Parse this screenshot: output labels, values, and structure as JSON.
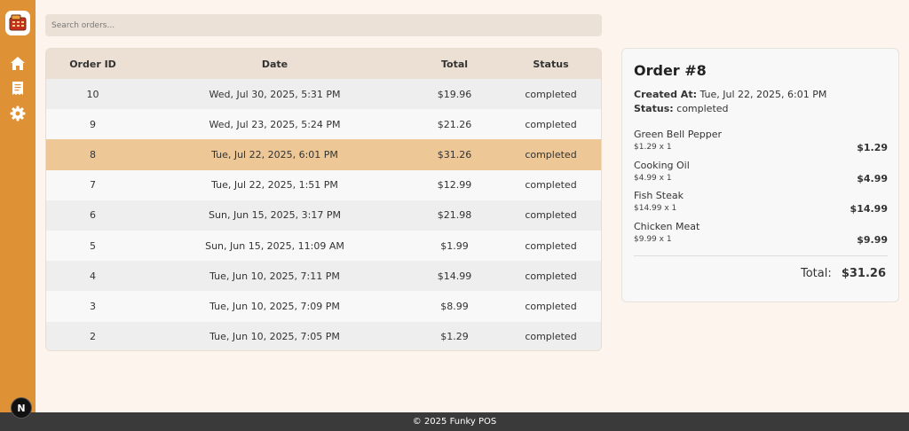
{
  "search": {
    "placeholder": "Search orders..."
  },
  "table": {
    "headers": [
      "Order ID",
      "Date",
      "Total",
      "Status"
    ],
    "rows": [
      {
        "id": "10",
        "date": "Wed, Jul 30, 2025, 5:31 PM",
        "total": "$19.96",
        "status": "completed"
      },
      {
        "id": "9",
        "date": "Wed, Jul 23, 2025, 5:24 PM",
        "total": "$21.26",
        "status": "completed"
      },
      {
        "id": "8",
        "date": "Tue, Jul 22, 2025, 6:01 PM",
        "total": "$31.26",
        "status": "completed",
        "selected": true
      },
      {
        "id": "7",
        "date": "Tue, Jul 22, 2025, 1:51 PM",
        "total": "$12.99",
        "status": "completed"
      },
      {
        "id": "6",
        "date": "Sun, Jun 15, 2025, 3:17 PM",
        "total": "$21.98",
        "status": "completed"
      },
      {
        "id": "5",
        "date": "Sun, Jun 15, 2025, 11:09 AM",
        "total": "$1.99",
        "status": "completed"
      },
      {
        "id": "4",
        "date": "Tue, Jun 10, 2025, 7:11 PM",
        "total": "$14.99",
        "status": "completed"
      },
      {
        "id": "3",
        "date": "Tue, Jun 10, 2025, 7:09 PM",
        "total": "$8.99",
        "status": "completed"
      },
      {
        "id": "2",
        "date": "Tue, Jun 10, 2025, 7:05 PM",
        "total": "$1.29",
        "status": "completed"
      }
    ]
  },
  "detail": {
    "title": "Order #8",
    "created_label": "Created At:",
    "created_value": "Tue, Jul 22, 2025, 6:01 PM",
    "status_label": "Status:",
    "status_value": "completed",
    "items": [
      {
        "name": "Green Bell Pepper",
        "qty": "$1.29 x 1",
        "price": "$1.29"
      },
      {
        "name": "Cooking Oil",
        "qty": "$4.99 x 1",
        "price": "$4.99"
      },
      {
        "name": "Fish Steak",
        "qty": "$14.99 x 1",
        "price": "$14.99"
      },
      {
        "name": "Chicken Meat",
        "qty": "$9.99 x 1",
        "price": "$9.99"
      }
    ],
    "total_label": "Total:",
    "total_value": "$31.26"
  },
  "sidebar": {
    "icons": [
      "home-icon",
      "receipt-icon",
      "gear-icon"
    ],
    "accent": "#de9235"
  },
  "badge": {
    "label": "N"
  },
  "footer": {
    "text": "© 2025 Funky POS"
  },
  "colors": {
    "selected_row": "#edc796",
    "header_bg": "#ebe0d3",
    "page_bg": "#fdf4ee"
  }
}
